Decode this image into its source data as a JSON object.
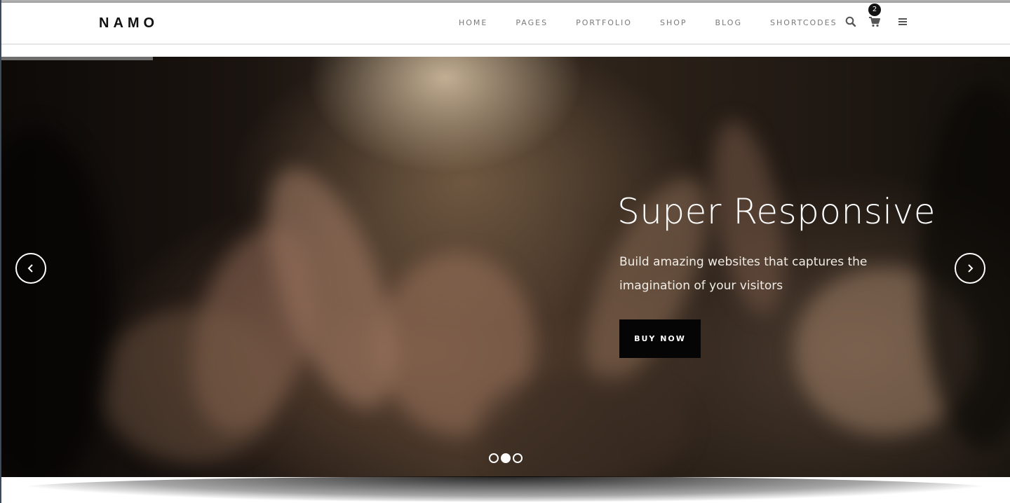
{
  "header": {
    "logo": "NAMO",
    "nav": [
      "HOME",
      "PAGES",
      "PORTFOLIO",
      "SHOP",
      "BLOG",
      "SHORTCODES"
    ],
    "cart_count": "2",
    "icons": {
      "search": "search-icon",
      "cart": "cart-icon",
      "menu": "hamburger-menu-icon"
    }
  },
  "slider": {
    "title": "Super Responsive",
    "subtitle": "Build amazing websites that captures the imagination of your visitors",
    "cta_label": "BUY NOW",
    "slide_count": 3,
    "active_slide": 2,
    "autoplay_progress": 0.15
  },
  "colors": {
    "accent": "#050505",
    "nav_text": "#7a7a7a",
    "logo": "#111111"
  }
}
